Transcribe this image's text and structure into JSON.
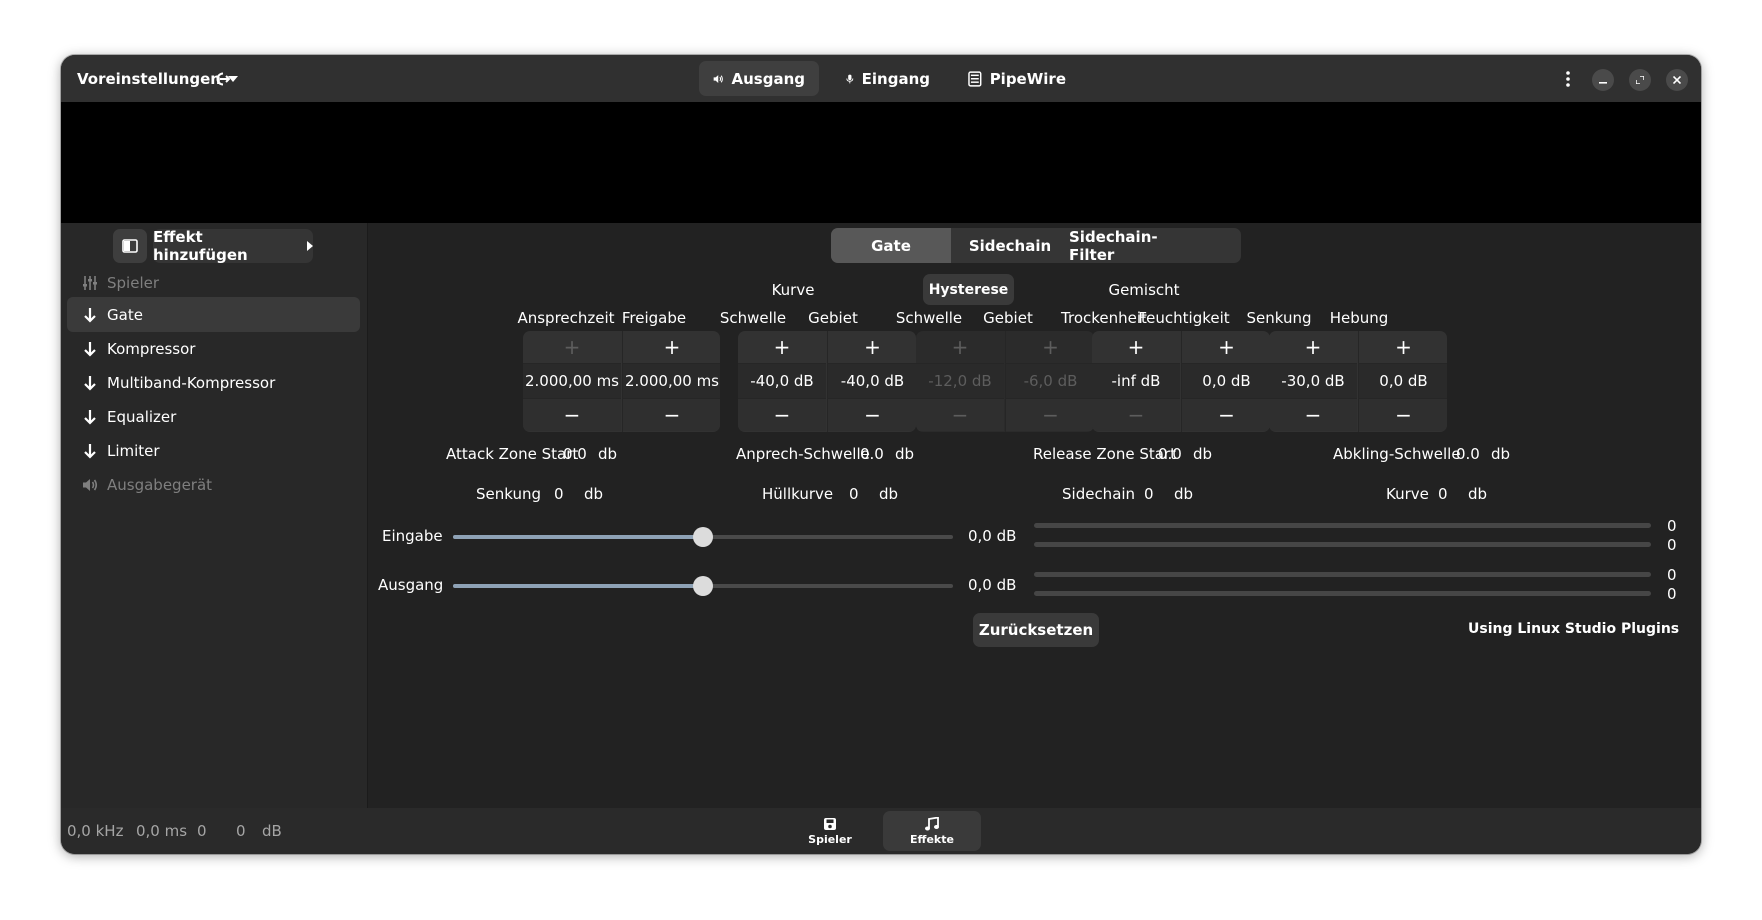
{
  "header": {
    "presets_label": "Voreinstellungen",
    "tabs": [
      {
        "label": "Ausgang",
        "icon": "speaker-icon"
      },
      {
        "label": "Eingang",
        "icon": "microphone-icon"
      },
      {
        "label": "PipeWire",
        "icon": "chip-icon"
      }
    ]
  },
  "sidebar": {
    "add_effect_label": "Effekt hinzufügen",
    "source_label": "Spieler",
    "items": [
      {
        "label": "Gate"
      },
      {
        "label": "Kompressor"
      },
      {
        "label": "Multiband-Kompressor"
      },
      {
        "label": "Equalizer"
      },
      {
        "label": "Limiter"
      }
    ],
    "sink_label": "Ausgabegerät"
  },
  "main": {
    "segments": [
      "Gate",
      "Sidechain",
      "Sidechain-Filter"
    ],
    "group_titles": {
      "curve": "Kurve",
      "hysteresis": "Hysterese",
      "mix": "Gemischt"
    },
    "controls": [
      {
        "label": "Ansprechzeit",
        "value": "2.000,00 ms"
      },
      {
        "label": "Freigabe",
        "value": "2.000,00 ms"
      },
      {
        "label": "Schwelle",
        "value": "-40,0 dB"
      },
      {
        "label": "Gebiet",
        "value": "-40,0 dB"
      },
      {
        "label": "Schwelle",
        "value": "-12,0 dB"
      },
      {
        "label": "Gebiet",
        "value": "-6,0 dB"
      },
      {
        "label": "Trockenheit",
        "value": "-inf dB"
      },
      {
        "label": "Feuchtigkeit",
        "value": "0,0 dB"
      },
      {
        "label": "Senkung",
        "value": "-30,0 dB"
      },
      {
        "label": "Hebung",
        "value": "0,0 dB"
      }
    ],
    "plus": "+",
    "minus": "−",
    "readouts_row1": [
      {
        "label": "Attack Zone Start",
        "value": "0.0",
        "unit": "db"
      },
      {
        "label": "Anprech-Schwelle",
        "value": "0.0",
        "unit": "db"
      },
      {
        "label": "Release Zone Start",
        "value": "0.0",
        "unit": "db"
      },
      {
        "label": "Abkling-Schwelle",
        "value": "0.0",
        "unit": "db"
      }
    ],
    "readouts_row2": [
      {
        "label": "Senkung",
        "value": "0",
        "unit": "db"
      },
      {
        "label": "Hüllkurve",
        "value": "0",
        "unit": "db"
      },
      {
        "label": "Sidechain",
        "value": "0",
        "unit": "db"
      },
      {
        "label": "Kurve",
        "value": "0",
        "unit": "db"
      }
    ],
    "input": {
      "label": "Eingabe",
      "value": "0,0 dB",
      "level": 0.5,
      "meter_left": "0",
      "meter_right": "0"
    },
    "output": {
      "label": "Ausgang",
      "value": "0,0 dB",
      "level": 0.5,
      "meter_left": "0",
      "meter_right": "0"
    },
    "reset_label": "Zurücksetzen",
    "plugin_info": "Using Linux Studio Plugins"
  },
  "footer": {
    "nav": [
      {
        "label": "Spieler",
        "icon": "save-icon"
      },
      {
        "label": "Effekte",
        "icon": "music-note-icon"
      }
    ],
    "status": {
      "rate": "0,0 kHz",
      "latency": "0,0 ms",
      "left": "0",
      "right": "0",
      "unit": "dB"
    }
  },
  "colors": {
    "accent": "#8ea2b6",
    "window_bg": "#1e1e1e",
    "header_bg": "#303030"
  }
}
